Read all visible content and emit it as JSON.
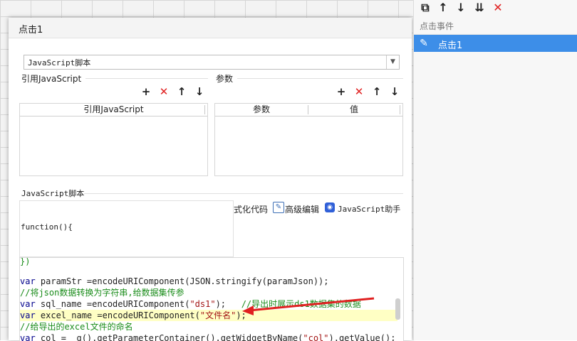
{
  "dialog": {
    "title": "点击1",
    "script_type": "JavaScript脚本",
    "ref_section": {
      "title": "引用JavaScript",
      "column": "引用JavaScript"
    },
    "param_section": {
      "title": "参数",
      "columns": [
        "参数",
        "值"
      ]
    },
    "script_section": {
      "title": "JavaScript脚本",
      "format_code": "式化代码",
      "advanced_edit": "高级编辑",
      "js_assistant": "JavaScript助手",
      "function_label": "function(){"
    },
    "code_lines": [
      {
        "text": "})",
        "type": "cmt"
      },
      {
        "text": "",
        "type": "plain"
      },
      {
        "text": "var paramStr =encodeURIComponent(JSON.stringify(paramJson));",
        "type": "code"
      },
      {
        "text": "//将json数据转换为字符串,给数据集传参",
        "type": "cmt"
      },
      {
        "text": "var sql_name =encodeURIComponent(\"ds1\");   //导出时展示ds1数据集的数据",
        "type": "code"
      },
      {
        "text": "var excel_name =encodeURIComponent(\"文件名\");",
        "type": "code",
        "highlight": true
      },
      {
        "text": "//给导出的excel文件的命名",
        "type": "cmt"
      },
      {
        "text": "var col = _g().getParameterContainer().getWidgetByName(\"col\").getValue();",
        "type": "code"
      }
    ]
  },
  "right_panel": {
    "header": "点击事件",
    "selected_item": "点击1"
  },
  "colors": {
    "accent": "#3d8ee8",
    "delete_red": "#e02020",
    "annotation_arrow": "#e02020",
    "highlight": "#ffffc4"
  },
  "icons": [
    "copy-icon",
    "arrow-up-icon",
    "arrow-down-icon",
    "move-to-bottom-icon",
    "delete-icon",
    "edit-pencil-icon",
    "add-icon",
    "edit-doc-icon",
    "assistant-icon"
  ]
}
